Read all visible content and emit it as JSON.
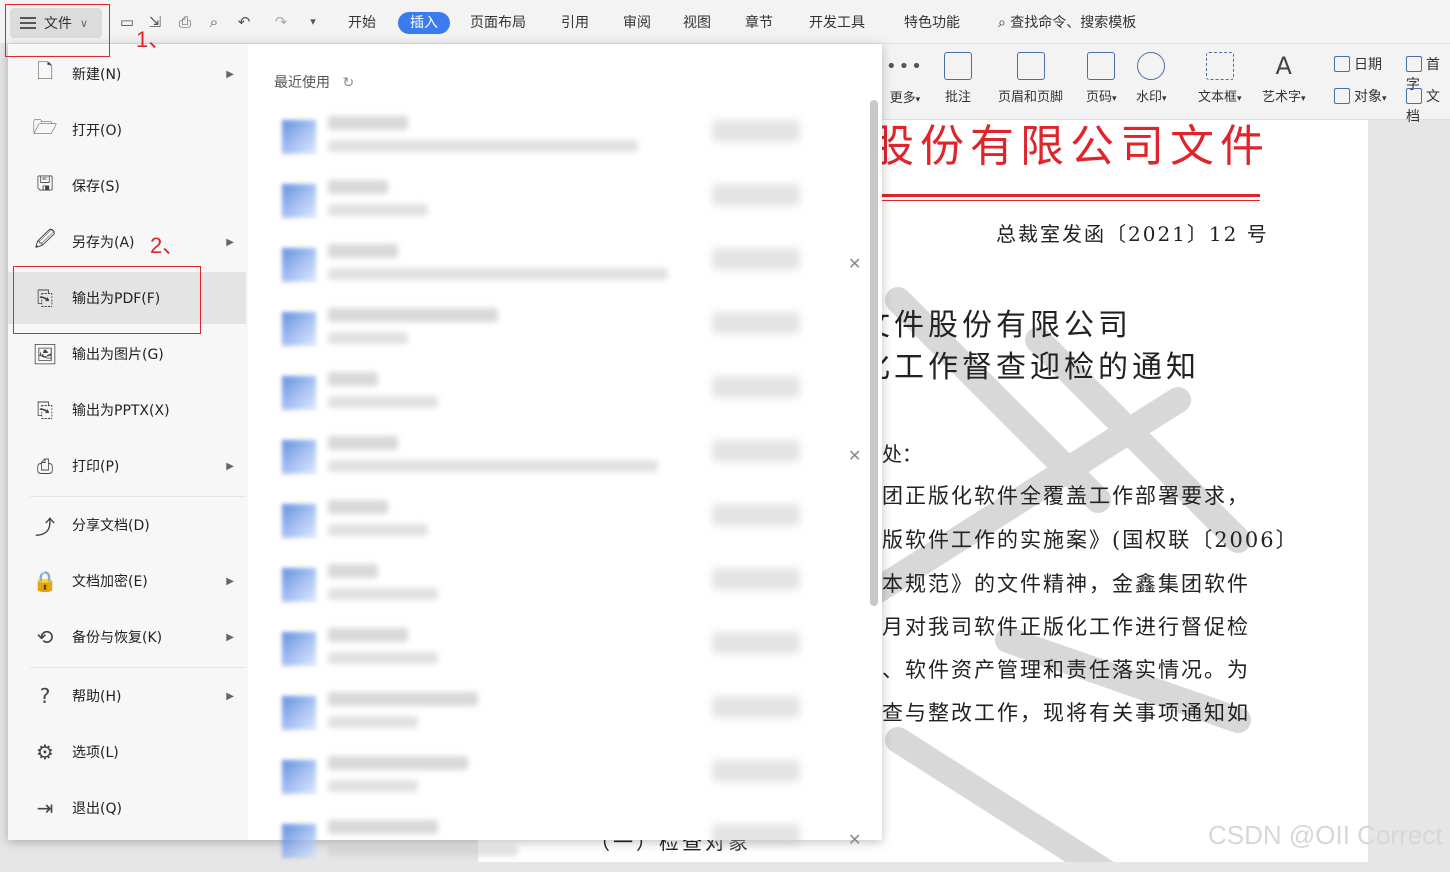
{
  "menubar": {
    "file_label": "文件",
    "tabs": [
      "开始",
      "插入",
      "页面布局",
      "引用",
      "审阅",
      "视图",
      "章节",
      "开发工具",
      "特色功能"
    ],
    "search_label": "查找命令、搜索模板",
    "active_tab": "插入",
    "accent_color": "#3a7bf0"
  },
  "annotations": {
    "step1": "1、",
    "step2": "2、",
    "color": "#e0242b"
  },
  "ribbon": {
    "more": "更多",
    "comment": "批注",
    "header_footer": "页眉和页脚",
    "page_number": "页码",
    "watermark": "水印",
    "textbox": "文本框",
    "wordart": "艺术字",
    "date": "日期",
    "object": "对象",
    "first": "首字",
    "doc": "文档"
  },
  "file_menu": {
    "items": [
      {
        "label": "新建(N)",
        "icon": "new-file-icon",
        "arrow": true
      },
      {
        "label": "打开(O)",
        "icon": "open-folder-icon",
        "arrow": false
      },
      {
        "label": "保存(S)",
        "icon": "save-icon",
        "arrow": false
      },
      {
        "label": "另存为(A)",
        "icon": "save-as-icon",
        "arrow": true
      },
      {
        "label": "输出为PDF(F)",
        "icon": "export-pdf-icon",
        "arrow": false
      },
      {
        "label": "输出为图片(G)",
        "icon": "export-image-icon",
        "arrow": false
      },
      {
        "label": "输出为PPTX(X)",
        "icon": "export-pptx-icon",
        "arrow": false
      },
      {
        "label": "打印(P)",
        "icon": "print-icon",
        "arrow": true
      },
      {
        "label": "分享文档(D)",
        "icon": "share-icon",
        "arrow": false
      },
      {
        "label": "文档加密(E)",
        "icon": "encrypt-icon",
        "arrow": true
      },
      {
        "label": "备份与恢复(K)",
        "icon": "backup-icon",
        "arrow": true
      },
      {
        "label": "帮助(H)",
        "icon": "help-icon",
        "arrow": true
      },
      {
        "label": "选项(L)",
        "icon": "gear-icon",
        "arrow": false
      },
      {
        "label": "退出(Q)",
        "icon": "exit-icon",
        "arrow": false
      }
    ],
    "selected": "输出为PDF(F)",
    "recent_title": "最近使用"
  },
  "document": {
    "red_title": "股份有限公司文件",
    "doc_number": "总裁室发函〔2021〕12 号",
    "heading_line1": "文件股份有限公司",
    "heading_line2": "化工作督查迎检的通知",
    "salutation": "处：",
    "body": [
      "团正版化软件全覆盖工作部署要求，",
      "版软件工作的实施案》(国权联〔2006〕",
      "本规范》的文件精神，金鑫集团软件",
      "月对我司软件正版化工作进行督促检",
      "、软件资产管理和责任落实情况。为",
      "查与整改工作，现将有关事项通知如"
    ],
    "bottom_line": "（一）检查对象"
  },
  "watermark_text": "CSDN @OII Correct"
}
